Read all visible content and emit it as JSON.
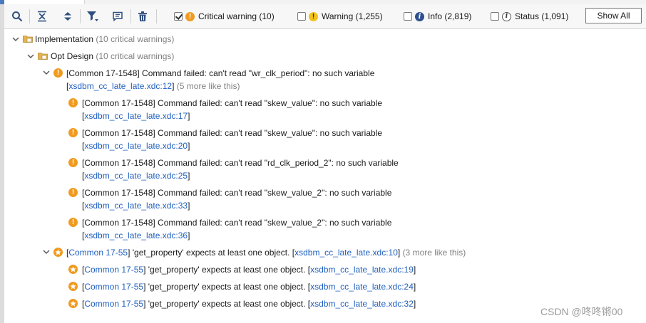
{
  "toolbar": {
    "filters": {
      "critical": {
        "label": "Critical warning (10)",
        "checked": true
      },
      "warning": {
        "label": "Warning (1,255)",
        "checked": false
      },
      "info": {
        "label": "Info (2,819)",
        "checked": false
      },
      "status": {
        "label": "Status (1,091)",
        "checked": false
      }
    },
    "show_all": "Show All"
  },
  "tree": {
    "implementation": {
      "label": "Implementation",
      "count": "(10 critical warnings)"
    },
    "opt_design": {
      "label": "Opt Design",
      "count": "(10 critical warnings)"
    },
    "group1": {
      "message": "[Common 17-1548] Command failed: can't read \"wr_clk_period\": no such variable",
      "open": "[",
      "link": "xsdbm_cc_late_late.xdc:12",
      "close": "]",
      "more": "(5 more like this)",
      "children": [
        {
          "message": "[Common 17-1548] Command failed: can't read \"skew_value\": no such variable",
          "open": "[",
          "link": "xsdbm_cc_late_late.xdc:17",
          "close": "]"
        },
        {
          "message": "[Common 17-1548] Command failed: can't read \"skew_value\": no such variable",
          "open": "[",
          "link": "xsdbm_cc_late_late.xdc:20",
          "close": "]"
        },
        {
          "message": "[Common 17-1548] Command failed: can't read \"rd_clk_period_2\": no such variable",
          "open": "[",
          "link": "xsdbm_cc_late_late.xdc:25",
          "close": "]"
        },
        {
          "message": "[Common 17-1548] Command failed: can't read \"skew_value_2\": no such variable",
          "open": "[",
          "link": "xsdbm_cc_late_late.xdc:33",
          "close": "]"
        },
        {
          "message": "[Common 17-1548] Command failed: can't read \"skew_value_2\": no such variable",
          "open": "[",
          "link": "xsdbm_cc_late_late.xdc:36",
          "close": "]"
        }
      ]
    },
    "group2": {
      "open": "[",
      "code_link": "Common 17-55",
      "text": "] 'get_property' expects at least one object. [",
      "file_link": "xsdbm_cc_late_late.xdc:10",
      "close": "]",
      "more": "(3 more like this)",
      "children": [
        {
          "open": "[",
          "code_link": "Common 17-55",
          "text": "] 'get_property' expects at least one object. [",
          "file_link": "xsdbm_cc_late_late.xdc:19",
          "close": "]"
        },
        {
          "open": "[",
          "code_link": "Common 17-55",
          "text": "] 'get_property' expects at least one object. [",
          "file_link": "xsdbm_cc_late_late.xdc:24",
          "close": "]"
        },
        {
          "open": "[",
          "code_link": "Common 17-55",
          "text": "] 'get_property' expects at least one object. [",
          "file_link": "xsdbm_cc_late_late.xdc:32",
          "close": "]"
        }
      ]
    }
  },
  "watermark": "CSDN @咚咚锵00",
  "colors": {
    "critical": "#f09a1f",
    "warning": "#f2c31a",
    "info": "#2e4f8f",
    "link": "#1f5fbf",
    "muted": "#808080"
  }
}
